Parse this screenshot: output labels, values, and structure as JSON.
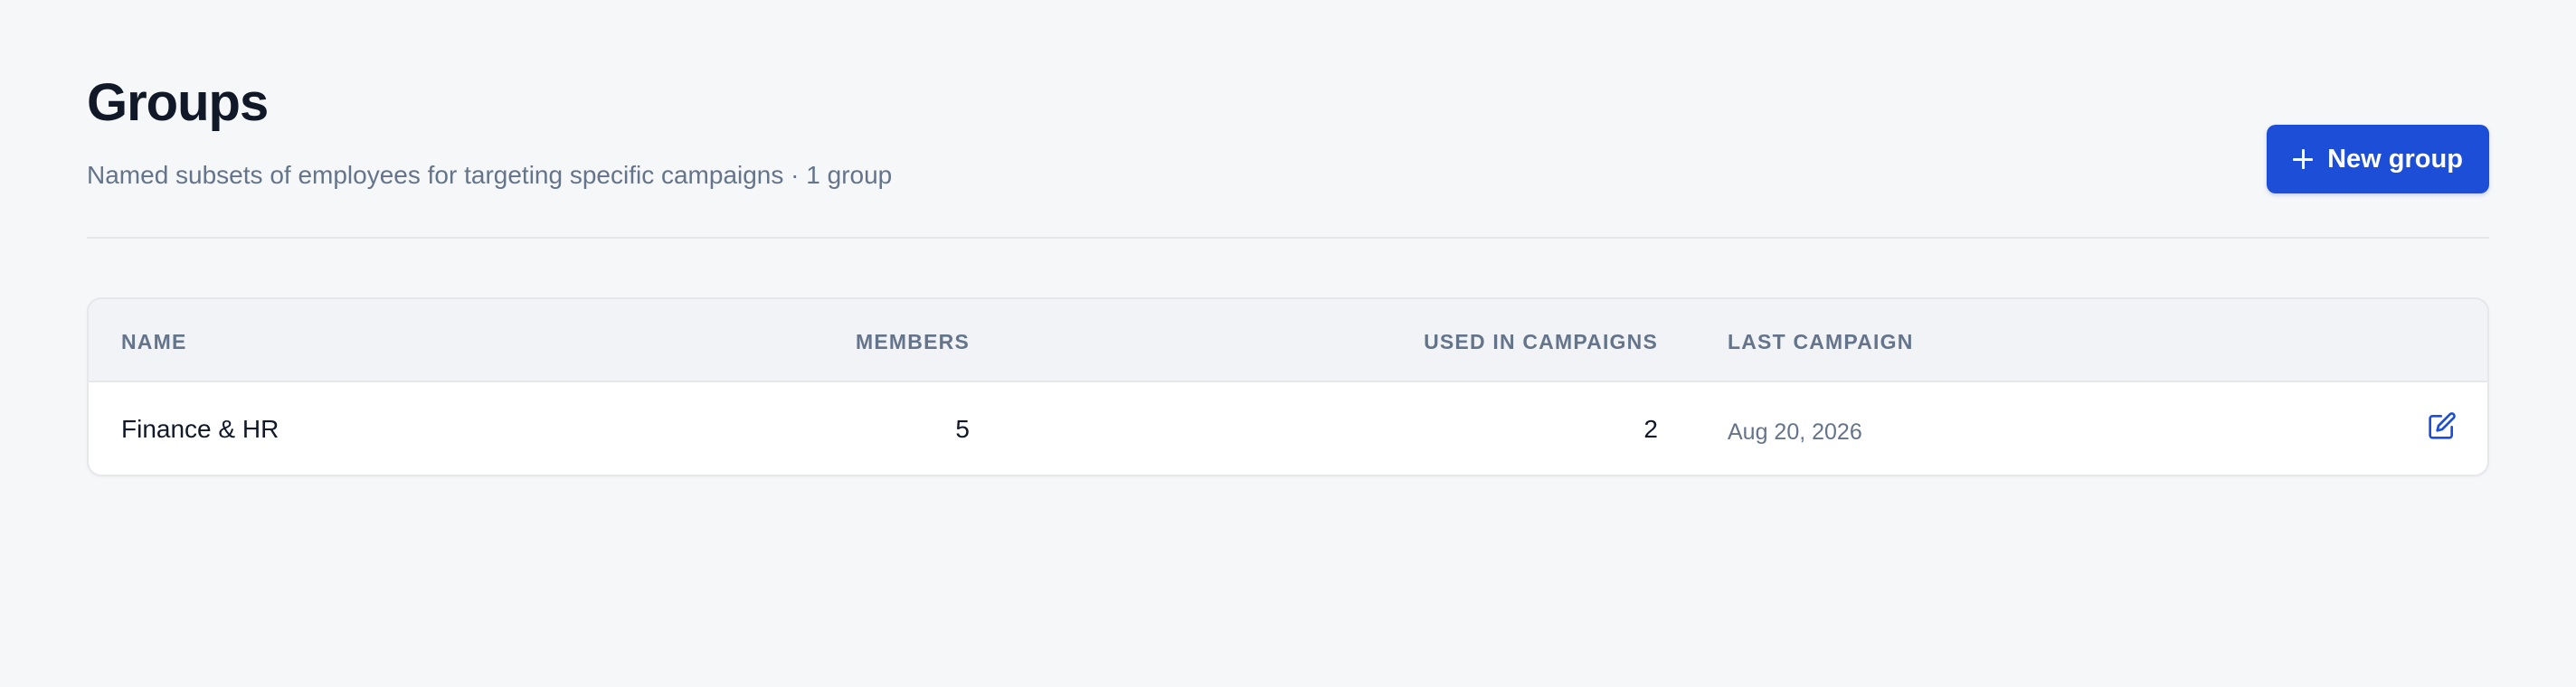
{
  "header": {
    "title": "Groups",
    "subtitle": "Named subsets of employees for targeting specific campaigns · 1 group",
    "new_group_label": "New group",
    "new_group_icon": "plus-icon"
  },
  "table": {
    "columns": {
      "name": "NAME",
      "members": "MEMBERS",
      "used_in_campaigns": "USED IN CAMPAIGNS",
      "last_campaign": "LAST CAMPAIGN"
    },
    "rows": [
      {
        "name": "Finance & HR",
        "members": "5",
        "used_in_campaigns": "2",
        "last_campaign": "Aug 20, 2026",
        "action_icon": "edit-icon"
      }
    ]
  },
  "colors": {
    "accent": "#1d4ed8",
    "background": "#f6f7f9",
    "muted_text": "#64748b"
  }
}
